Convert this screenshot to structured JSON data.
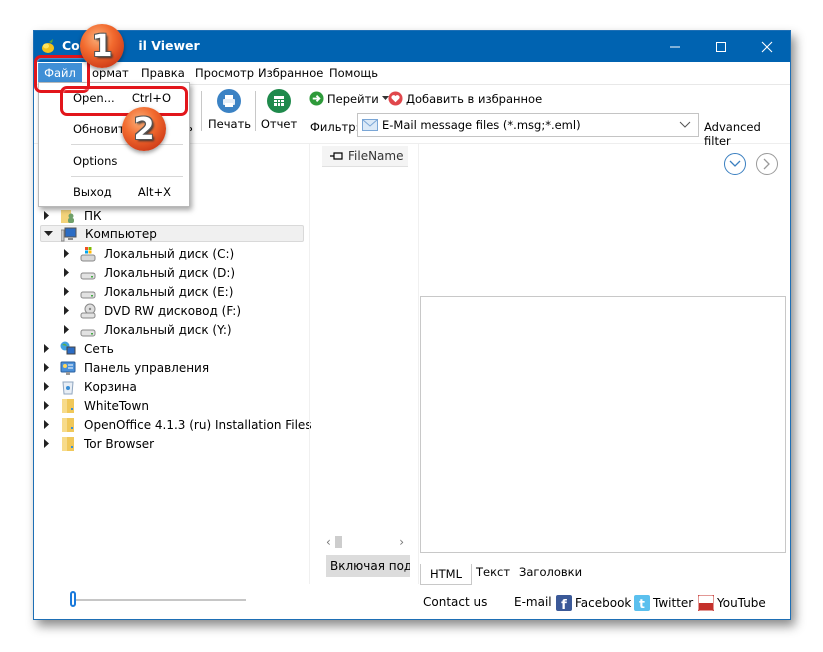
{
  "window": {
    "title": "CoolUtils Mail Viewer",
    "title_visible_left": "Coo",
    "title_visible_right": "il Viewer",
    "accent": "#0063b1"
  },
  "menubar": {
    "items": [
      "Файл",
      "Формат",
      "Правка",
      "Просмотр",
      "Избранное",
      "Помощь"
    ],
    "format_visible": "ормат"
  },
  "file_menu": {
    "items": [
      {
        "label": "Open...",
        "shortcut": "Ctrl+O"
      },
      {
        "label": "Обновить",
        "shortcut": ""
      },
      {
        "label": "Options",
        "shortcut": ""
      },
      {
        "label": "Выход",
        "shortcut": "Alt+X"
      }
    ]
  },
  "toolbar": {
    "hidden_partial": "ь",
    "print_label": "Печать",
    "report_label": "Отчет",
    "goto_label": "Перейти",
    "favorites_label": "Добавить в избранное",
    "filter_label": "Фильтр:",
    "filter_value": "E-Mail message files (*.msg;*.eml)",
    "advanced_filter_label": "Advanced filter"
  },
  "tree": {
    "items": [
      {
        "label": "ПК",
        "icon": "user-folder-icon",
        "level": 0,
        "expanded": false
      },
      {
        "label": "Компьютер",
        "icon": "computer-icon",
        "level": 0,
        "expanded": true,
        "selected": true
      },
      {
        "label": "Локальный диск (C:)",
        "icon": "system-drive-icon",
        "level": 1,
        "expanded": false
      },
      {
        "label": "Локальный диск (D:)",
        "icon": "drive-icon",
        "level": 1,
        "expanded": false
      },
      {
        "label": "Локальный диск (E:)",
        "icon": "drive-icon",
        "level": 1,
        "expanded": false
      },
      {
        "label": "DVD RW дисковод (F:)",
        "icon": "dvd-drive-icon",
        "level": 1,
        "expanded": false
      },
      {
        "label": "Локальный диск (Y:)",
        "icon": "drive-icon",
        "level": 1,
        "expanded": false
      },
      {
        "label": "Сеть",
        "icon": "network-icon",
        "level": 0,
        "expanded": false
      },
      {
        "label": "Панель управления",
        "icon": "control-panel-icon",
        "level": 0,
        "expanded": false
      },
      {
        "label": "Корзина",
        "icon": "recycle-bin-icon",
        "level": 0,
        "expanded": false
      },
      {
        "label": "WhiteTown",
        "icon": "folder-icon",
        "level": 0,
        "expanded": false
      },
      {
        "label": "OpenOffice 4.1.3 (ru) Installation Files",
        "icon": "folder-icon",
        "level": 0,
        "expanded": false
      },
      {
        "label": "Tor Browser",
        "icon": "folder-icon",
        "level": 0,
        "expanded": false
      }
    ]
  },
  "filelist": {
    "column_header": "FileName",
    "include_subfolders_label": "Включая подд"
  },
  "preview": {
    "tabs": [
      "HTML",
      "Текст",
      "Заголовки"
    ],
    "active_tab": "HTML"
  },
  "footer": {
    "slider_value": 0,
    "contact_label": "Contact us",
    "email_label": "E-mail",
    "facebook_label": "Facebook",
    "twitter_label": "Twitter",
    "youtube_label": "YouTube"
  },
  "annotations": {
    "step1": "1",
    "step2": "2",
    "color": "#e2151b"
  }
}
